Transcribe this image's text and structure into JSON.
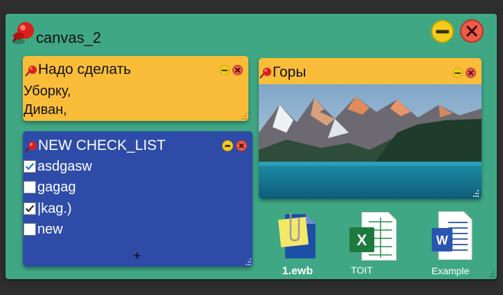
{
  "canvas": {
    "title": "canvas_2",
    "colors": {
      "background": "#3fa784",
      "pin": "#d9201c"
    }
  },
  "notes": [
    {
      "title": "Надо сделать",
      "lines": [
        "Уборку,",
        "Диван,"
      ],
      "color": "#f9bd3a"
    }
  ],
  "checklist": {
    "title": "NEW CHECK_LIST",
    "color": "#2e4ba8",
    "items": [
      {
        "label": "asdgasw",
        "checked": true
      },
      {
        "label": "gagag",
        "checked": false
      },
      {
        "label": "|kag.)",
        "checked": true
      },
      {
        "label": "new",
        "checked": false
      }
    ],
    "add_label": "+"
  },
  "image_note": {
    "title": "Горы",
    "image": "mountain-lake-photo"
  },
  "files": [
    {
      "label": "1.ewb",
      "icon": "ewb-file-icon"
    },
    {
      "label": "TOIT",
      "icon": "excel-file-icon"
    },
    {
      "label": "Example",
      "icon": "word-file-icon"
    }
  ]
}
